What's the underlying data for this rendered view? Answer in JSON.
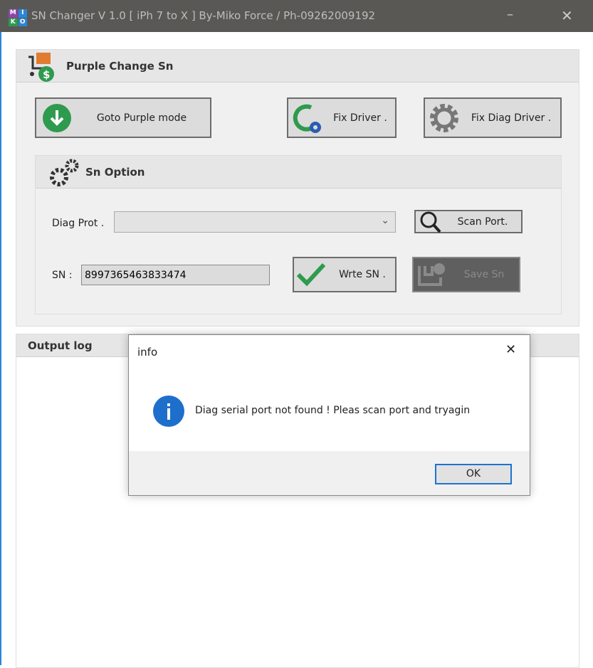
{
  "window": {
    "title": "SN Changer V 1.0  [ iPh 7 to X ] By-Miko Force  / Ph-09262009192",
    "logo_letters": [
      "M",
      "I",
      "K",
      "O"
    ],
    "minimize": "–",
    "close": "✕"
  },
  "purple_group": {
    "title": "Purple  Change Sn",
    "goto_purple": "Goto Purple mode",
    "fix_driver": "Fix Driver .",
    "fix_diag_driver": "Fix Diag Driver ."
  },
  "sn_option": {
    "title": "Sn Option",
    "diag_port_label": "Diag Prot .",
    "diag_port_value": "",
    "scan_port": "Scan Port.",
    "sn_label": "SN :",
    "sn_value": "8997365463833474",
    "write_sn": "Wrte SN .",
    "save_sn": "Save Sn"
  },
  "output_log": {
    "title": "Output log"
  },
  "dialog": {
    "title": "info",
    "message": "Diag serial port not found ! Pleas scan port and tryagin",
    "ok": "OK",
    "close": "✕"
  },
  "colors": {
    "accent": "#2a86d6",
    "green": "#2e9a4e",
    "titlebar": "#5a5855"
  }
}
